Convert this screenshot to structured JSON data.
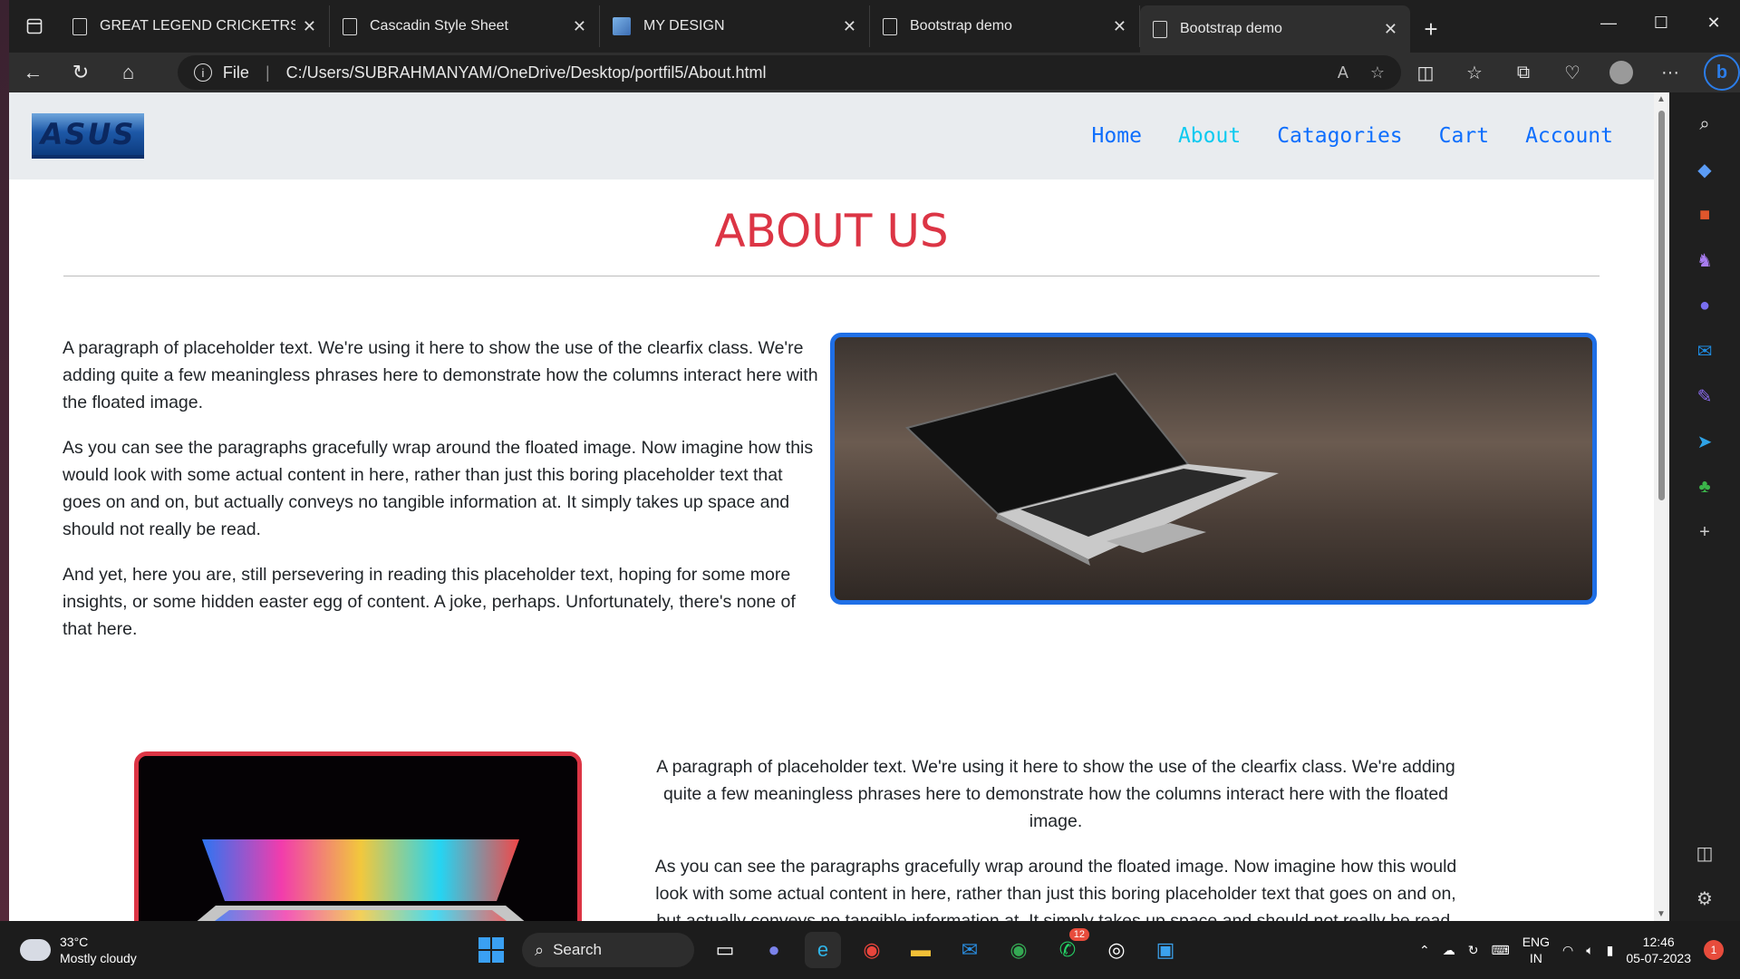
{
  "browser": {
    "tabs": [
      {
        "title": "GREAT LEGEND CRICKETRS",
        "icon": "page-icon"
      },
      {
        "title": "Cascadin Style Sheet",
        "icon": "page-icon"
      },
      {
        "title": "MY DESIGN",
        "icon": "image-icon"
      },
      {
        "title": "Bootstrap demo",
        "icon": "page-icon"
      },
      {
        "title": "Bootstrap demo",
        "icon": "page-icon",
        "active": true
      }
    ],
    "address": {
      "scheme_label": "File",
      "url": "C:/Users/SUBRAHMANYAM/OneDrive/Desktop/portfil5/About.html"
    },
    "accent_color": "#2b7de9"
  },
  "site": {
    "logo_text": "ASUS",
    "nav": [
      "Home",
      "About",
      "Catagories",
      "Cart",
      "Account"
    ],
    "active_nav": "About",
    "title": "ABOUT US",
    "title_color": "#dc3545",
    "section1": {
      "paragraphs": [
        "A paragraph of placeholder text. We're using it here to show the use of the clearfix class. We're adding quite a few meaningless phrases here to demonstrate how the columns interact here with the floated image.",
        "As you can see the paragraphs gracefully wrap around the floated image. Now imagine how this would look with some actual content in here, rather than just this boring placeholder text that goes on and on, but actually conveys no tangible information at. It simply takes up space and should not really be read.",
        "And yet, here you are, still persevering in reading this placeholder text, hoping for some more insights, or some hidden easter egg of content. A joke, perhaps. Unfortunately, there's none of that here."
      ],
      "image_border_color": "#1f6fe6"
    },
    "section2": {
      "paragraphs": [
        "A paragraph of placeholder text. We're using it here to show the use of the clearfix class. We're adding quite a few meaningless phrases here to demonstrate how the columns interact here with the floated image.",
        "As you can see the paragraphs gracefully wrap around the floated image. Now imagine how this would look with some actual content in here, rather than just this boring placeholder text that goes on and on, but actually conveys no tangible information at. It simply takes up space and should not really be read."
      ],
      "image_border_color": "#dc3545"
    }
  },
  "taskbar": {
    "weather": {
      "temp": "33°C",
      "condition": "Mostly cloudy"
    },
    "search_label": "Search",
    "whatsapp_badge": "12",
    "language": {
      "line1": "ENG",
      "line2": "IN"
    },
    "clock": {
      "time": "12:46",
      "date": "05-07-2023"
    },
    "notification_count": "1"
  }
}
